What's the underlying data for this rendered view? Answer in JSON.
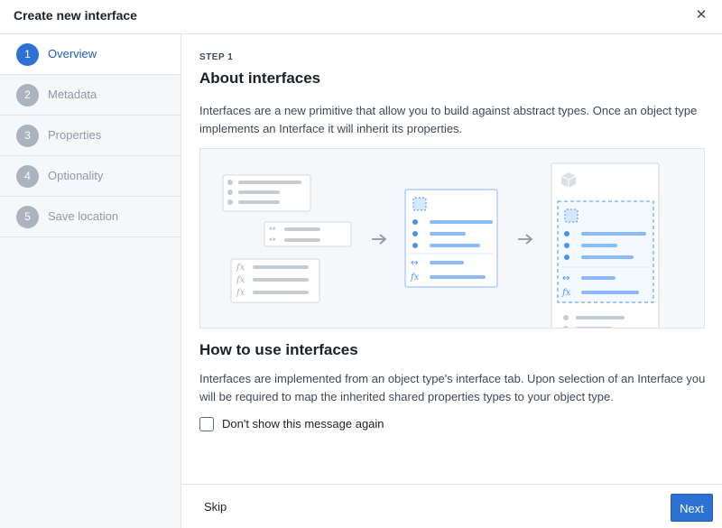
{
  "dialog": {
    "title": "Create new interface",
    "close_icon": "close-icon"
  },
  "sidebar": {
    "steps": [
      {
        "number": "1",
        "label": "Overview",
        "active": true
      },
      {
        "number": "2",
        "label": "Metadata",
        "active": false
      },
      {
        "number": "3",
        "label": "Properties",
        "active": false
      },
      {
        "number": "4",
        "label": "Optionality",
        "active": false
      },
      {
        "number": "5",
        "label": "Save location",
        "active": false
      }
    ]
  },
  "main": {
    "eyebrow": "STEP 1",
    "title": "About interfaces",
    "description": "Interfaces are a new primitive that allow you to build against abstract types. Once an object type implements an Interface it will inherit its properties.",
    "usage_title": "How to use interfaces",
    "usage_description": "Interfaces are implemented from an object type's interface tab. Upon selection of an Interface you will be required to map the inherited shared properties types to your object type.",
    "checkbox_label": "Don't show this message again",
    "checkbox_checked": false
  },
  "illustration": {
    "fx_glyph": "fx",
    "link_glyph": "↔",
    "arrow_glyph": "→",
    "accent_color": "#4c90f0",
    "light_accent_color": "#8abbff",
    "gray_color": "#c5cbd3"
  },
  "footer": {
    "skip_label": "Skip",
    "next_label": "Next"
  },
  "colors": {
    "primary": "#2d72d2",
    "sidebar_bg": "#f6f7f9",
    "step_inactive": "#abb3bf"
  }
}
